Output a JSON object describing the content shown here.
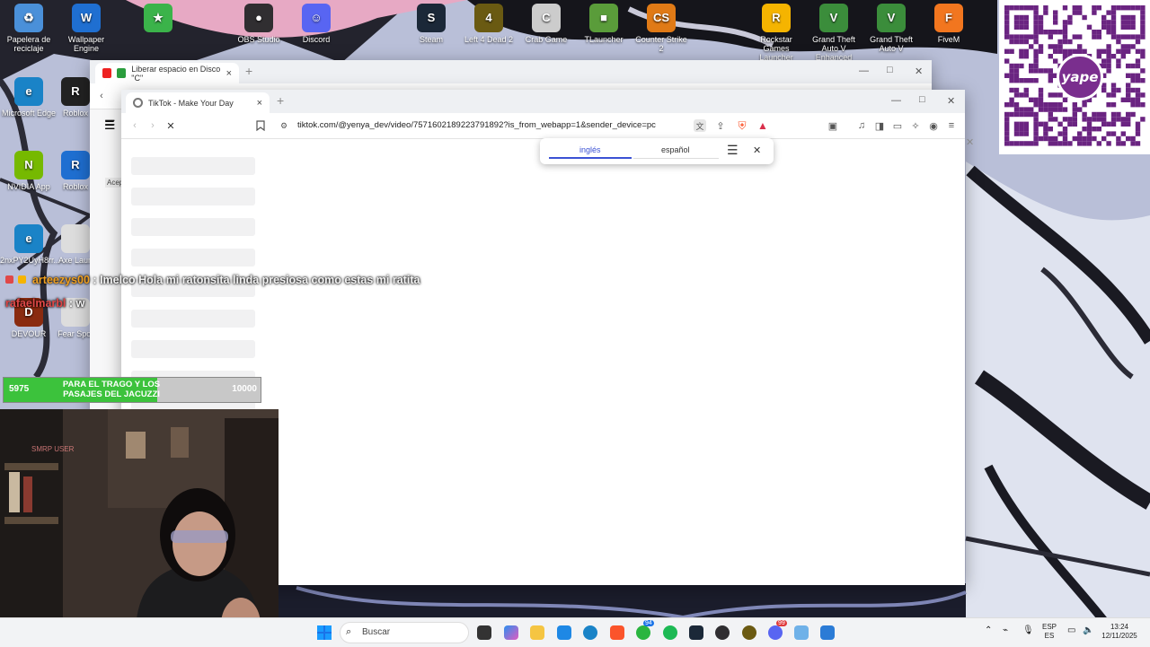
{
  "desktop": {
    "icons": [
      {
        "label": "Papelera de reciclaje",
        "color": "#4a90d9",
        "glyph": "♻"
      },
      {
        "label": "Wallpaper Engine",
        "color": "#1f6fd1",
        "glyph": "W"
      },
      {
        "label": "",
        "color": "#3bb34a",
        "glyph": "★"
      },
      {
        "label": "OBS Studio",
        "color": "#302e31",
        "glyph": "●"
      },
      {
        "label": "Discord",
        "color": "#5865f2",
        "glyph": "☺"
      },
      {
        "label": "Steam",
        "color": "#1b2838",
        "glyph": "S"
      },
      {
        "label": "Left 4 Dead 2",
        "color": "#6a5a12",
        "glyph": "4"
      },
      {
        "label": "Crab Game",
        "color": "#cccccc",
        "glyph": "C"
      },
      {
        "label": "TLauncher",
        "color": "#5a9c3a",
        "glyph": "■"
      },
      {
        "label": "Counter Strike 2",
        "color": "#e07a16",
        "glyph": "CS"
      },
      {
        "label": "Rockstar Games Launcher",
        "color": "#f5b400",
        "glyph": "R"
      },
      {
        "label": "Grand Theft Auto V Enhanced",
        "color": "#3b8d3b",
        "glyph": "V"
      },
      {
        "label": "Grand Theft Auto V",
        "color": "#3b8d3b",
        "glyph": "V"
      },
      {
        "label": "FiveM",
        "color": "#f2761f",
        "glyph": "F"
      },
      {
        "label": "Microsoft Edge",
        "color": "#1a83c7",
        "glyph": "e"
      },
      {
        "label": "Roblox",
        "color": "#222222",
        "glyph": "R"
      },
      {
        "label": "NVIDIA App",
        "color": "#76b900",
        "glyph": "N"
      },
      {
        "label": "Roblox",
        "color": "#1f6fd1",
        "glyph": "R"
      },
      {
        "label": "2nxPY2UyH8rr...",
        "color": "#1a83c7",
        "glyph": "e"
      },
      {
        "label": "Axe Laun",
        "color": "#dddddd",
        "glyph": ""
      },
      {
        "label": "DEVOUR",
        "color": "#8a2b10",
        "glyph": "D"
      },
      {
        "label": "Fear Spot",
        "color": "#dddddd",
        "glyph": ""
      }
    ]
  },
  "back_window": {
    "tab_title": "Liberar espacio en Disco \"C\"",
    "tab_close": "×",
    "new_tab": "+",
    "minimize": "—",
    "maximize": "□",
    "close": "✕",
    "side_label": "Acep"
  },
  "browser": {
    "tab_title": "TikTok - Make Your Day",
    "tab_close": "×",
    "new_tab": "+",
    "minimize": "—",
    "maximize": "□",
    "close": "✕",
    "url": "tiktok.com/@yenya_dev/video/7571602189223791892?is_from_webapp=1&sender_device=pc",
    "translate": {
      "lang_from": "inglés",
      "lang_to": "español",
      "menu": "☰",
      "close": "✕"
    },
    "skeleton_rows": 9
  },
  "stream_overlay": {
    "chat": [
      {
        "user": "arteezys00",
        "separator": ":",
        "message": "Imelco Hola mi ratonsita linda presiosa como estas mi ratita",
        "user_color": "#f0a020"
      },
      {
        "user": "rafaelmarbl",
        "separator": ":",
        "message": "w",
        "user_color": "#e04848"
      }
    ],
    "goal": {
      "current": "5975",
      "label": "PARA EL TRAGO Y LOS PASAJES DEL JACUZZI",
      "target": "10000",
      "progress": 0.5975
    },
    "webcam_caption": "SMRP USER"
  },
  "taskbar": {
    "search_placeholder": "Buscar",
    "whatsapp_badge": "94",
    "discord_badge": "99",
    "language": "ESP",
    "language_sub": "ES",
    "time": "13:24",
    "date": "12/11/2025"
  },
  "colors": {
    "tiktok_accent": "#fe2c55",
    "translate_accent": "#3b52d4",
    "goal_fill": "#3cc23c"
  }
}
